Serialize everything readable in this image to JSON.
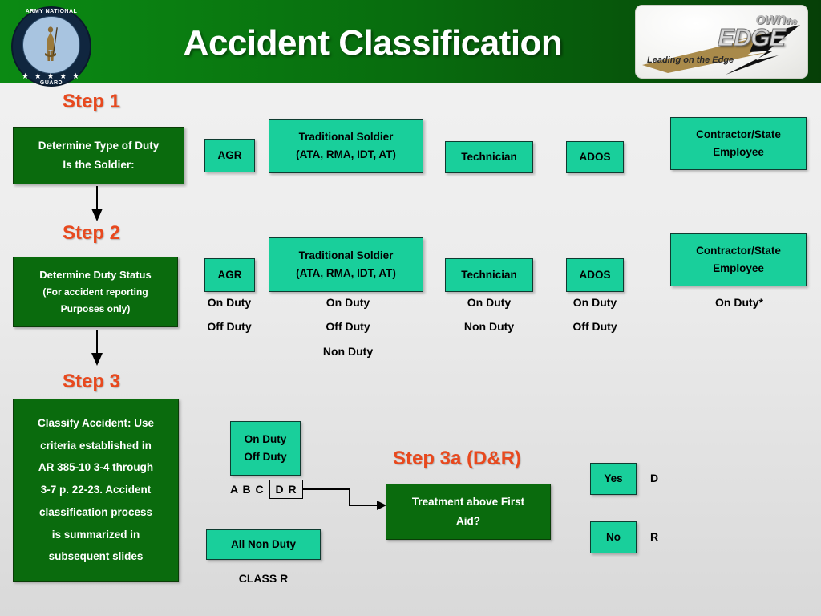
{
  "header": {
    "title": "Accident Classification",
    "seal": {
      "arc_top": "ARMY NATIONAL",
      "arc_bottom": "GUARD",
      "stars": "★ ★ ★ ★ ★"
    },
    "edge_logo": {
      "own": "own",
      "the": "the",
      "edge": "EDGE",
      "tagline": "Leading on the Edge"
    }
  },
  "steps": {
    "step1_label": "Step 1",
    "step2_label": "Step 2",
    "step3_label": "Step 3",
    "step3a_label": "Step 3a (D&R)"
  },
  "step1": {
    "prompt_line1": "Determine Type of Duty",
    "prompt_line2": "Is the Soldier:",
    "categories": [
      {
        "line1": "AGR",
        "line2": ""
      },
      {
        "line1": "Traditional Soldier",
        "line2": "(ATA, RMA, IDT, AT)"
      },
      {
        "line1": "Technician",
        "line2": ""
      },
      {
        "line1": "ADOS",
        "line2": ""
      },
      {
        "line1": "Contractor/State",
        "line2": "Employee"
      }
    ]
  },
  "step2": {
    "prompt_line1": "Determine Duty Status",
    "prompt_line2": "(For accident reporting",
    "prompt_line3": "Purposes only)",
    "columns": [
      {
        "box_line1": "AGR",
        "box_line2": "",
        "statuses": [
          "On Duty",
          "Off Duty"
        ]
      },
      {
        "box_line1": "Traditional Soldier",
        "box_line2": "(ATA, RMA, IDT, AT)",
        "statuses": [
          "On Duty",
          "Off Duty",
          "Non Duty"
        ]
      },
      {
        "box_line1": "Technician",
        "box_line2": "",
        "statuses": [
          "On Duty",
          "Non Duty"
        ]
      },
      {
        "box_line1": "ADOS",
        "box_line2": "",
        "statuses": [
          "On Duty",
          "Off Duty"
        ]
      },
      {
        "box_line1": "Contractor/State",
        "box_line2": "Employee",
        "statuses": [
          "On Duty*"
        ]
      }
    ]
  },
  "step3": {
    "classify_lines": [
      "Classify Accident:  Use",
      "criteria established in",
      "AR 385-10 3-4 through",
      "3-7 p. 22-23.  Accident",
      "classification process",
      "is summarized in",
      "subsequent slides"
    ],
    "on_off_box_line1": "On Duty",
    "on_off_box_line2": "Off Duty",
    "class_abc": "A B C",
    "class_dr": "D R",
    "all_non_duty": "All Non Duty",
    "class_r": "CLASS R"
  },
  "step3a": {
    "question_line1": "Treatment above First",
    "question_line2": "Aid?",
    "answers": [
      {
        "box": "Yes",
        "code": "D"
      },
      {
        "box": "No",
        "code": "R"
      }
    ]
  },
  "colors": {
    "header_green_light": "#0b8a13",
    "header_green_dark": "#063f07",
    "dark_box": "#0a6b0d",
    "teal_box": "#19cf9b",
    "step_accent": "#e8491e",
    "background": "#ececec"
  }
}
